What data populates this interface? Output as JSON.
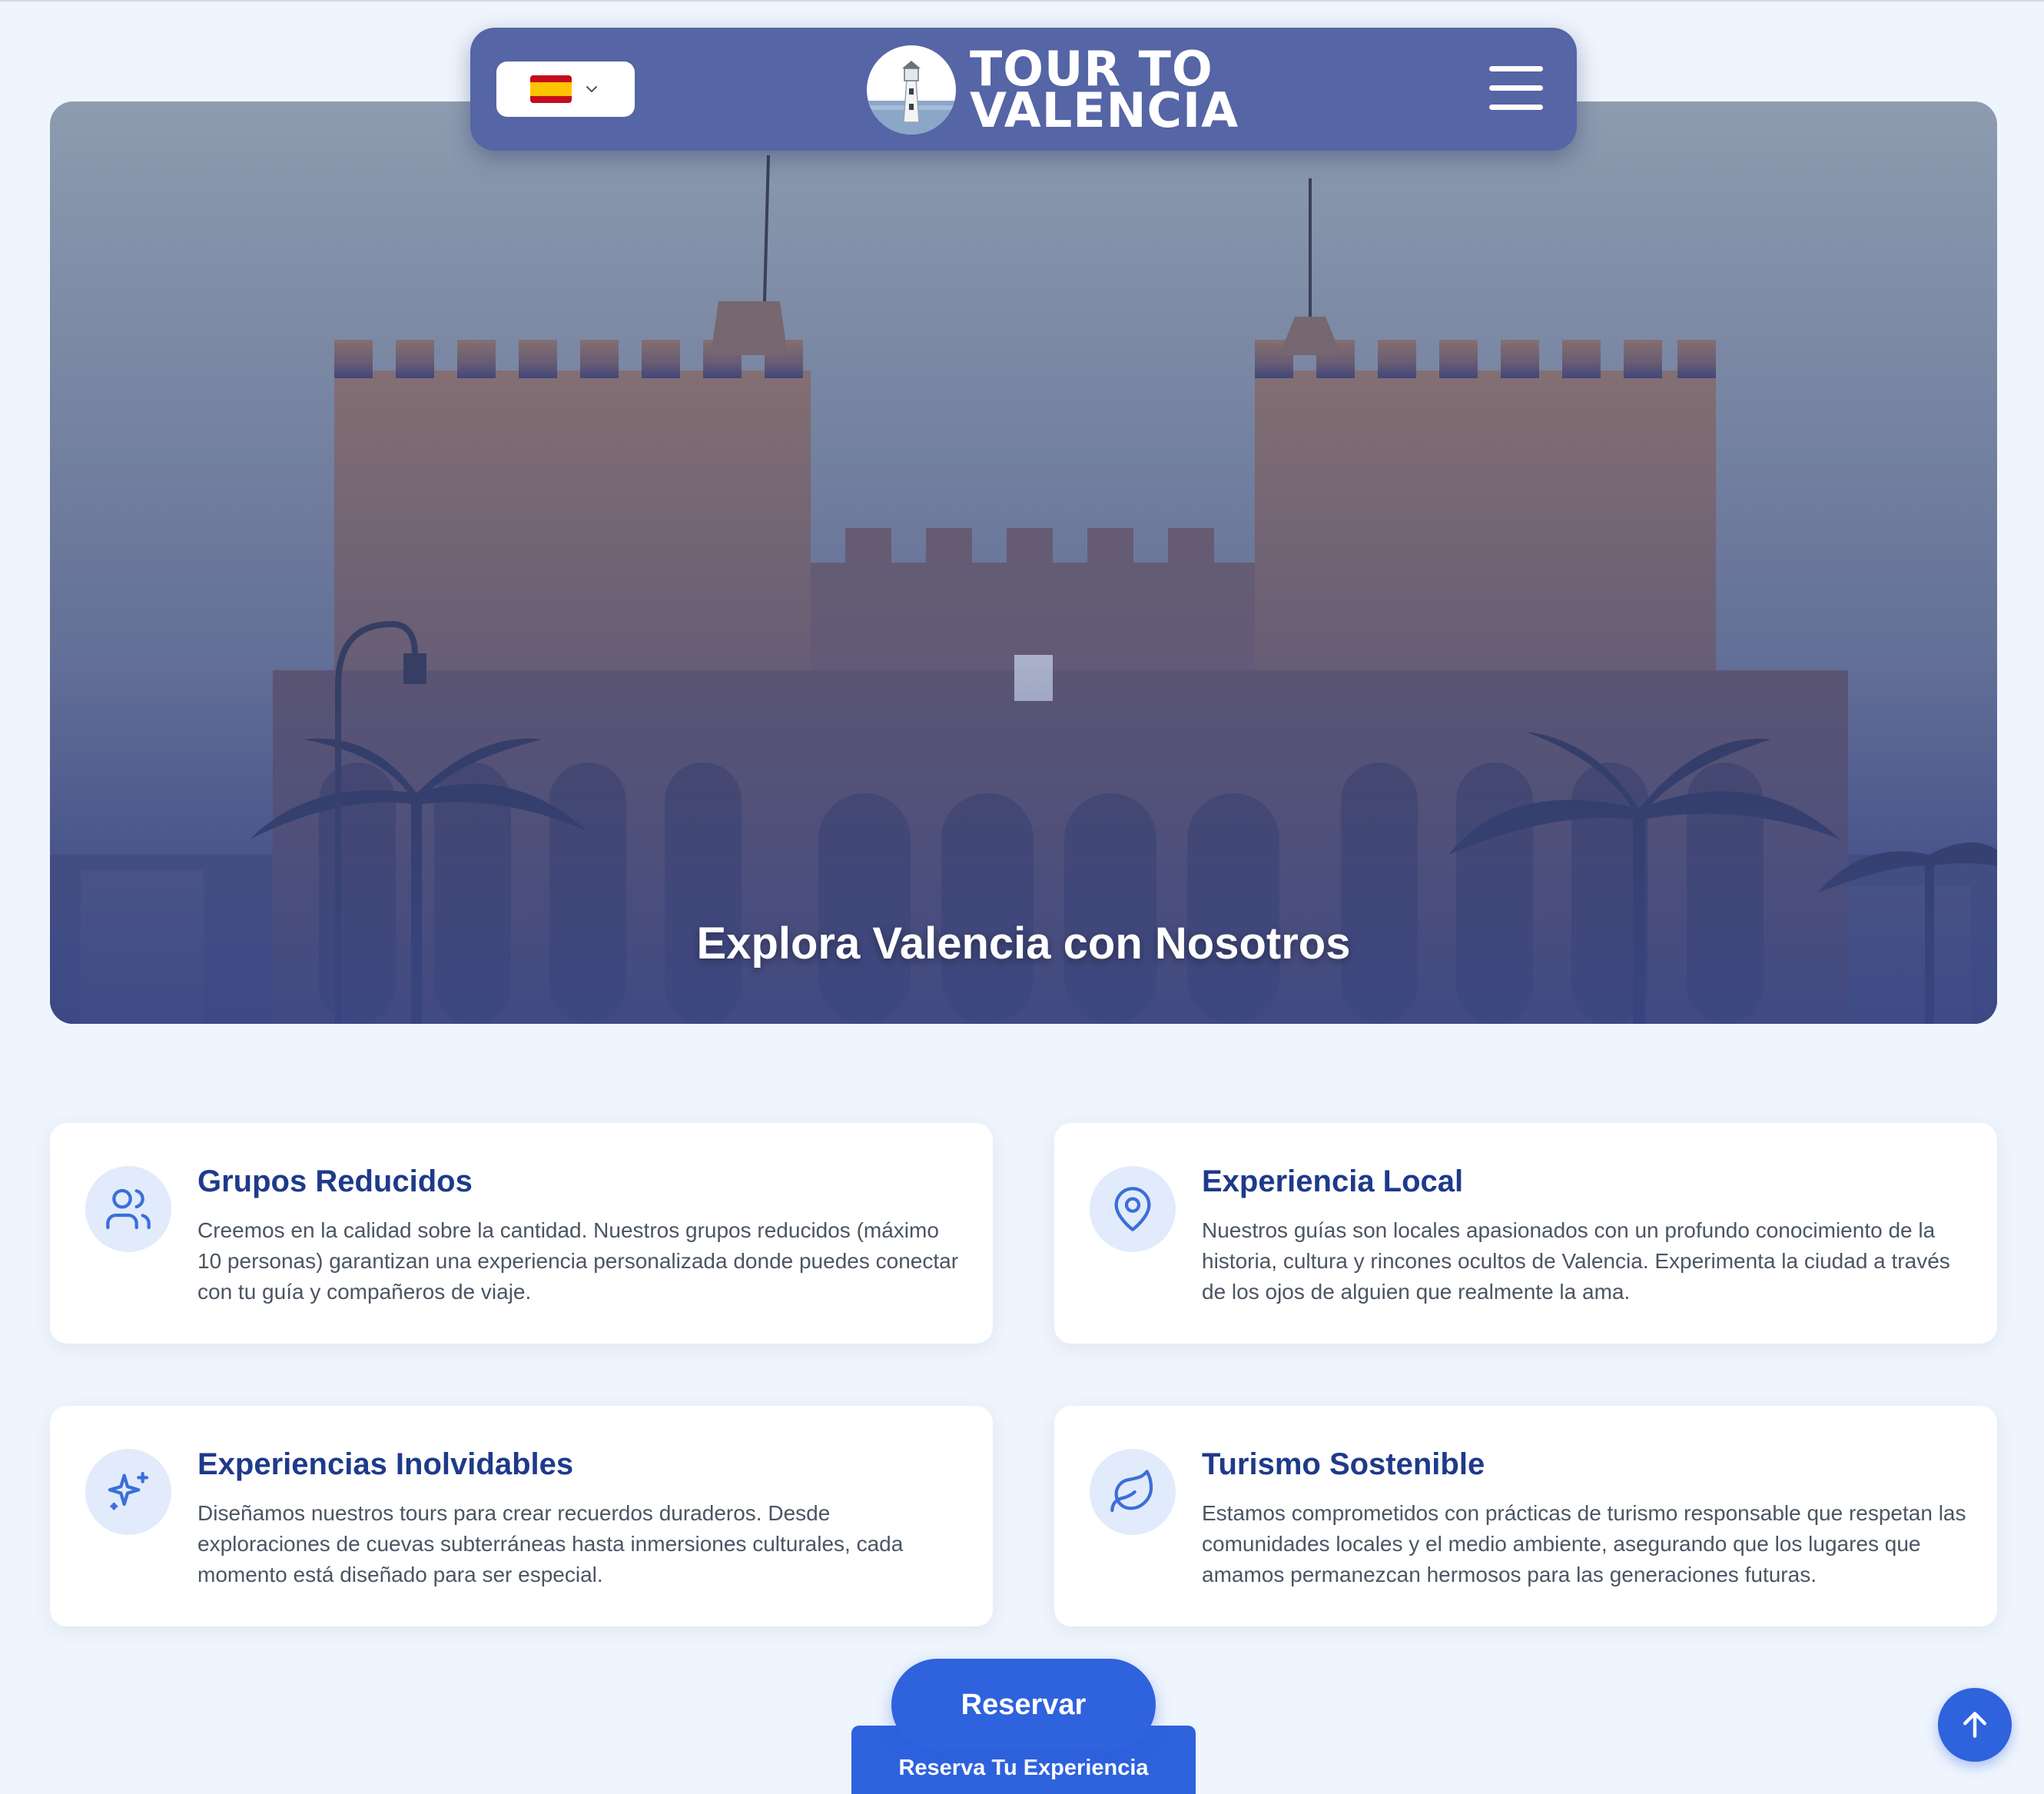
{
  "nav": {
    "language": "es",
    "brand_line1": "TOUR TO",
    "brand_line2": "VALENCIA"
  },
  "hero": {
    "title": "Explora Valencia con Nosotros"
  },
  "features": [
    {
      "icon": "users-icon",
      "title": "Grupos Reducidos",
      "text": "Creemos en la calidad sobre la cantidad. Nuestros grupos reducidos (máximo 10 personas) garantizan una experiencia personalizada donde puedes conectar con tu guía y compañeros de viaje."
    },
    {
      "icon": "map-pin-icon",
      "title": "Experiencia Local",
      "text": "Nuestros guías son locales apasionados con un profundo conocimiento de la historia, cultura y rincones ocultos de Valencia. Experimenta la ciudad a través de los ojos de alguien que realmente la ama."
    },
    {
      "icon": "sparkles-icon",
      "title": "Experiencias Inolvidables",
      "text": "Diseñamos nuestros tours para crear recuerdos duraderos. Desde exploraciones de cuevas subterráneas hasta inmersiones culturales, cada momento está diseñado para ser especial."
    },
    {
      "icon": "leaf-icon",
      "title": "Turismo Sostenible",
      "text": "Estamos comprometidos con prácticas de turismo responsable que respetan las comunidades locales y el medio ambiente, asegurando que los lugares que amamos permanezcan hermosos para las generaciones futuras."
    }
  ],
  "cta": {
    "reserve_label": "Reservar",
    "book_label": "Reserva Tu Experiencia"
  },
  "colors": {
    "primary": "#2f62dd",
    "nav": "#5565a5",
    "heading": "#1e3a8a",
    "background": "#eff5fd"
  }
}
